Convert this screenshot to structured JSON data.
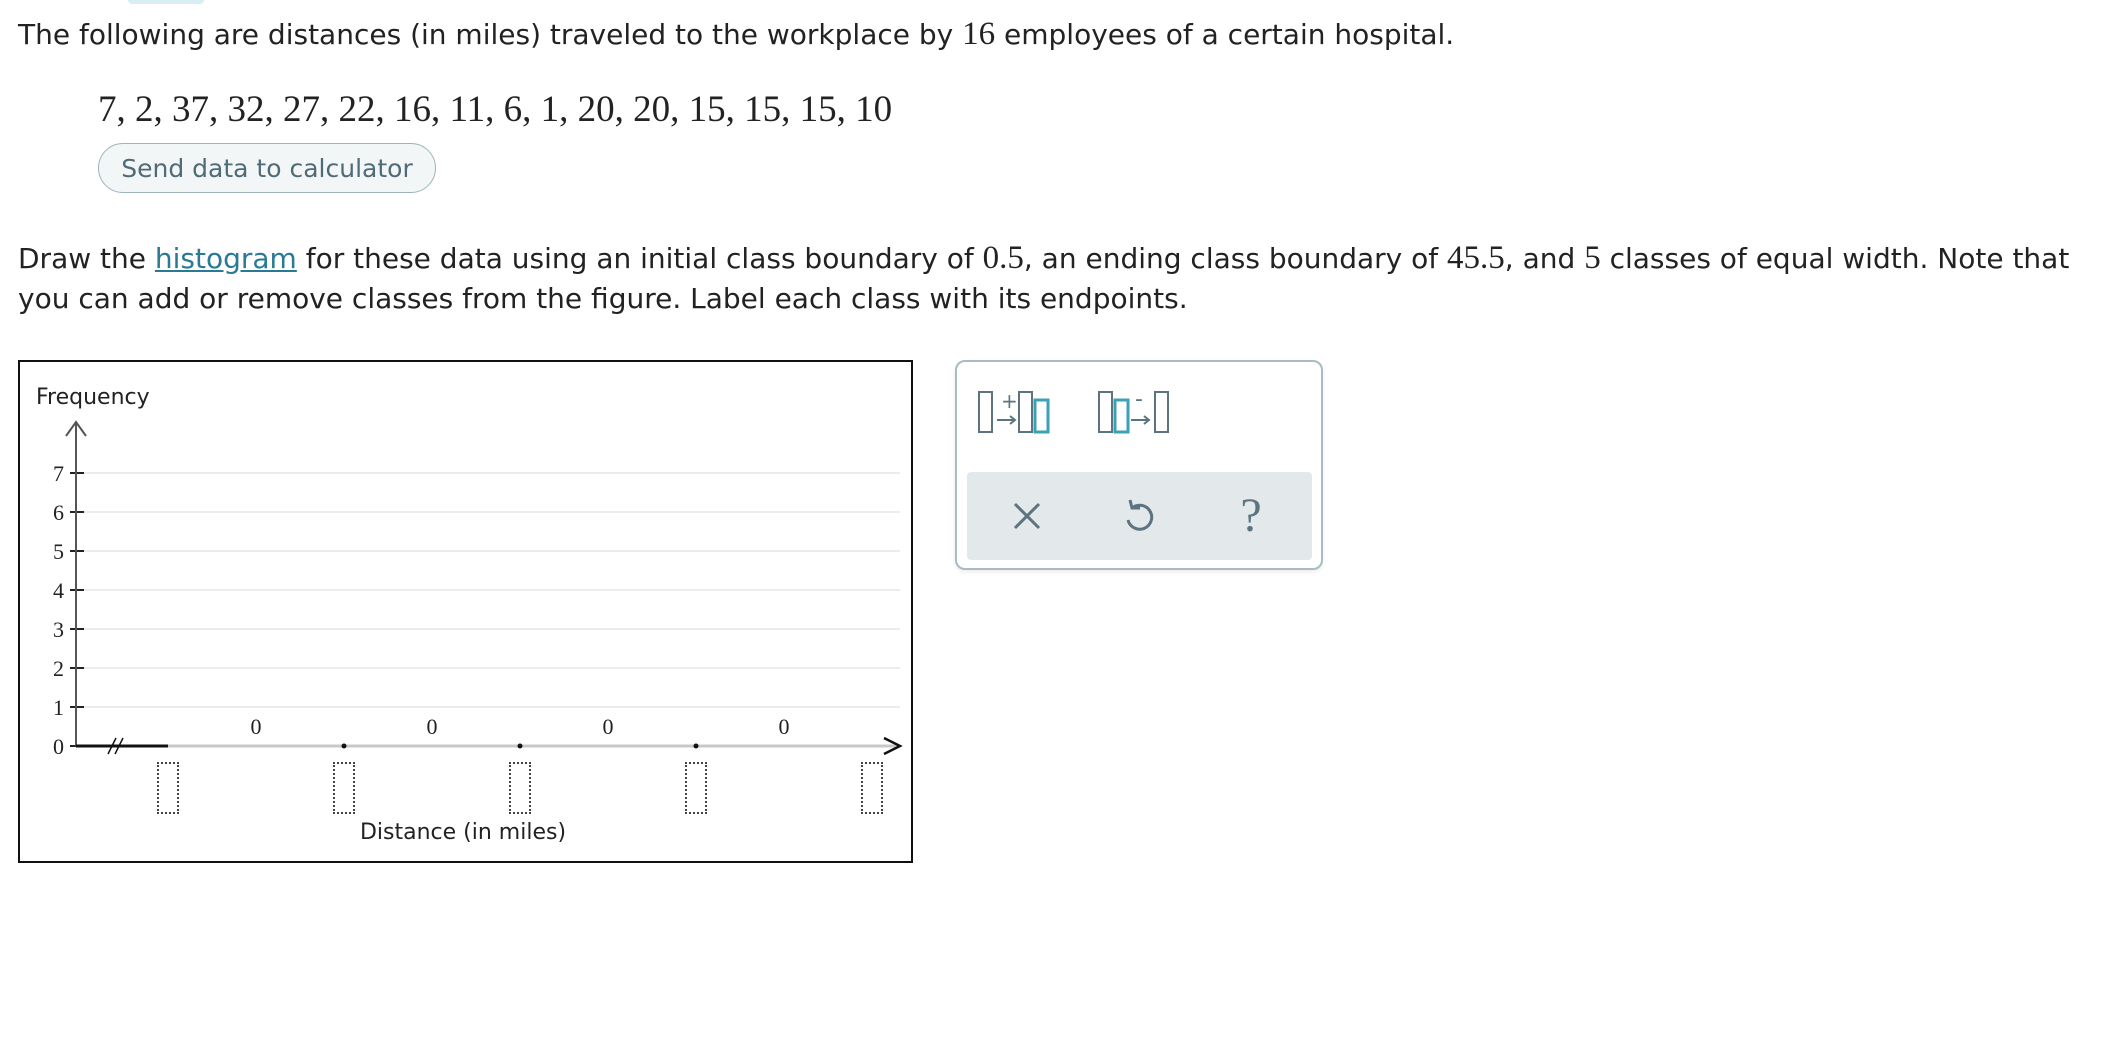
{
  "intro": {
    "text_before": "The following are distances (in miles) traveled to the workplace by ",
    "count": "16",
    "text_after": " employees of a certain hospital."
  },
  "dataset": {
    "values_text": "7, 2, 37, 32, 27, 22, 16, 11, 6, 1, 20, 20, 15, 15, 15, 10"
  },
  "send_button": {
    "label": "Send data to calculator"
  },
  "instructions": {
    "part1": "Draw the ",
    "link": "histogram",
    "part2": " for these data using an initial class boundary of ",
    "initial_boundary": "0.5",
    "part3": ", an ending class boundary of ",
    "ending_boundary": "45.5",
    "part4": ", and ",
    "num_classes": "5",
    "part5": " classes of equal width. Note that you can add or remove classes from the figure. Label each class with its endpoints."
  },
  "graph": {
    "y_axis_title": "Frequency",
    "x_axis_title": "Distance (in miles)",
    "y_ticks": [
      "0",
      "1",
      "2",
      "3",
      "4",
      "5",
      "6",
      "7"
    ],
    "bar_values": [
      0,
      0,
      0,
      0
    ],
    "bar_labels": [
      "0",
      "0",
      "0",
      "0"
    ],
    "endpoint_placeholders": [
      "",
      "",
      "",
      "",
      ""
    ],
    "colors": {
      "axis": "#222222",
      "grid": "#e6e6e6",
      "baseline": "#c8c8c8",
      "arrow": "#555555"
    }
  },
  "tools": {
    "add_class_icon": "add-class-icon",
    "remove_class_icon": "remove-class-icon",
    "clear_icon": "x-icon",
    "undo_icon": "undo-icon",
    "help_icon": "question-icon",
    "help_glyph": "?",
    "accent": "#3aa0b4",
    "icon_gray": "#5b7480"
  }
}
